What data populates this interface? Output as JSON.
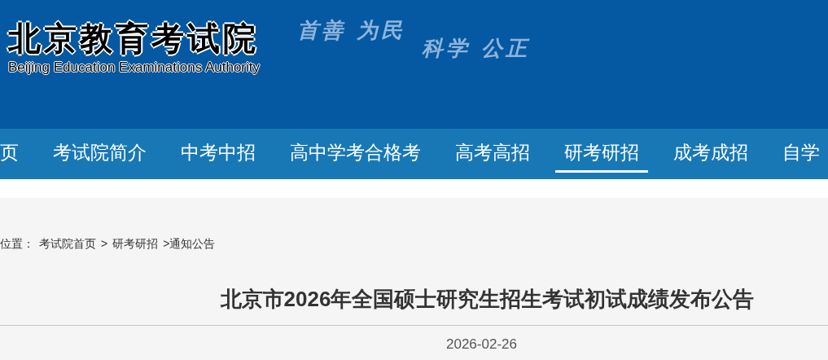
{
  "header": {
    "logo_title": "北京教育考试院",
    "logo_subtitle": "Beijing Education Examinations Authority",
    "slogans": [
      "首善 为民",
      "科学 公正"
    ]
  },
  "nav": [
    {
      "label": "页",
      "selected": false
    },
    {
      "label": "考试院简介",
      "selected": false
    },
    {
      "label": "中考中招",
      "selected": false
    },
    {
      "label": "高中学考合格考",
      "selected": false
    },
    {
      "label": "高考高招",
      "selected": false
    },
    {
      "label": "研考研招",
      "selected": true
    },
    {
      "label": "成考成招",
      "selected": false
    },
    {
      "label": "自学",
      "selected": false
    }
  ],
  "breadcrumb": [
    "位置：",
    "考试院首页",
    ">",
    "研考研招",
    ">通知公告"
  ],
  "article": {
    "title": "北京市2026年全国硕士研究生招生考试初试成绩发布公告",
    "date": "2026-02-26"
  }
}
